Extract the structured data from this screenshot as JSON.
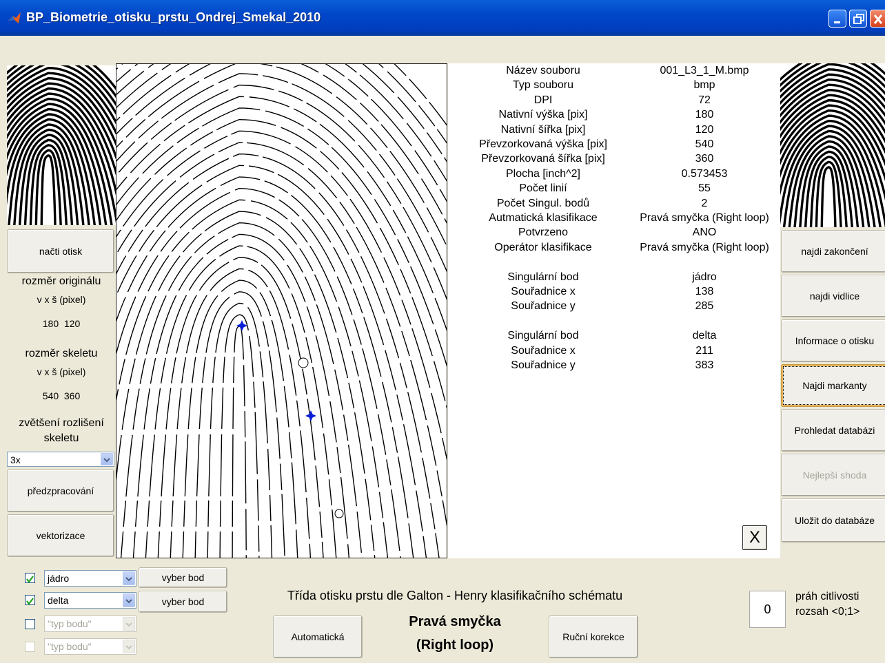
{
  "window": {
    "title": "BP_Biometrie_otisku_prstu_Ondrej_Smekal_2010"
  },
  "left": {
    "load_button": "načti otisk",
    "orig_size_label": "rozměr originálu",
    "orig_size_unit": "v x š (pixel)",
    "orig_size_value": "180  120",
    "skel_size_label": "rozměr skeletu",
    "skel_size_unit": "v x š (pixel)",
    "skel_size_value": "540  360",
    "zoom_label_1": "zvětšení rozlišení",
    "zoom_label_2": "skeletu",
    "zoom_select": "3x",
    "preprocess_button": "předzpracování",
    "vectorize_button": "vektorizace"
  },
  "info": {
    "rows": [
      {
        "k": "Název souboru",
        "v": "001_L3_1_M.bmp"
      },
      {
        "k": "Typ souboru",
        "v": "bmp"
      },
      {
        "k": "DPI",
        "v": "72"
      },
      {
        "k": "Nativní výška [pix]",
        "v": "180"
      },
      {
        "k": "Nativní šířka [pix]",
        "v": "120"
      },
      {
        "k": "Převzorkovaná výška [pix]",
        "v": "540"
      },
      {
        "k": "Převzorkovaná šířka [pix]",
        "v": "360"
      },
      {
        "k": "Plocha [inch^2]",
        "v": "0.573453"
      },
      {
        "k": "Počet linií",
        "v": "55"
      },
      {
        "k": "Počet Singul. bodů",
        "v": "2"
      },
      {
        "k": "Autmatická klasifikace",
        "v": "Pravá smyčka (Right loop)"
      },
      {
        "k": "Potvrzeno",
        "v": "ANO"
      },
      {
        "k": "Operátor klasifikace",
        "v": "Pravá smyčka (Right loop)"
      },
      {
        "k": "",
        "v": ""
      },
      {
        "k": "Singulární bod",
        "v": "jádro"
      },
      {
        "k": "Souřadnice x",
        "v": "138"
      },
      {
        "k": "Souřadnice y",
        "v": "285"
      },
      {
        "k": "",
        "v": ""
      },
      {
        "k": "Singulární bod",
        "v": "delta"
      },
      {
        "k": "Souřadnice x",
        "v": "211"
      },
      {
        "k": "Souřadnice y",
        "v": "383"
      }
    ],
    "close_label": "X"
  },
  "right": {
    "endings_button": "najdi zakončení",
    "forks_button": "najdi vidlice",
    "info_button": "Informace o otisku",
    "minutiae_button": "Najdi markanty",
    "search_db_button": "Prohledat databázi",
    "best_match_button": "Nejlepší shoda",
    "save_db_button": "Uložit do databáze"
  },
  "bottom": {
    "point_rows": [
      {
        "type": "jádro",
        "button": "vyber bod"
      },
      {
        "type": "delta",
        "button": "vyber bod"
      },
      {
        "type": "\"typ bodu\""
      },
      {
        "type": "\"typ bodu\""
      }
    ],
    "class_heading": "Třída otisku prstu dle Galton - Henry klasifikačního schématu",
    "auto_button": "Automatická",
    "result_line1": "Pravá smyčka",
    "result_line2": "(Right loop)",
    "manual_button": "Ruční korekce",
    "threshold_value": "0",
    "threshold_label1": "práh citlivosti",
    "threshold_label2": "rozsah <0;1>"
  },
  "colors": {
    "titlebar": "#0147c9",
    "marker": "#0a1fd6",
    "background": "#ece9d8"
  }
}
